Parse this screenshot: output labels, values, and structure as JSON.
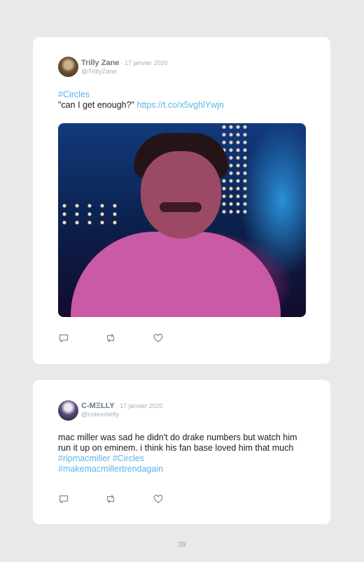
{
  "tweets": [
    {
      "author_name": "Trilly Zane",
      "date": "· 17 janvier 2020",
      "handle": "@TrillyZane",
      "line1": "#Circles",
      "line2_text": "\"can I get enough?\" ",
      "line2_link": "https://t.co/x5vghlYwjn",
      "has_media": true
    },
    {
      "author_name": "C-MΞLLY",
      "date": "· 17 janvier 2020",
      "handle": "@colexmelly",
      "body_text": "mac miller was sad he didn't do drake numbers but watch him run it up on eminem. i think his fan base loved him that much ",
      "hashtag1": "#ripmacmiller",
      "hashtag2": "#Circles",
      "hashtag3": "#makemacmillertrendagain"
    }
  ],
  "icons": [
    "reply-icon",
    "retweet-icon",
    "like-icon"
  ],
  "colors": {
    "link": "#5cb4e6",
    "background": "#e8e9eb",
    "card": "#ffffff"
  },
  "page_number": "39"
}
